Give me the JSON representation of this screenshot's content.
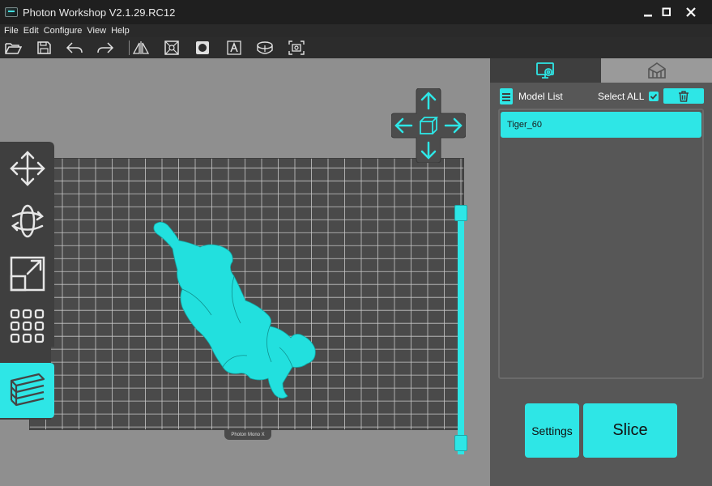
{
  "window": {
    "title": "Photon Workshop V2.1.29.RC12",
    "icon": "app-icon",
    "controls": [
      "minimize-icon",
      "maximize-icon",
      "close-icon"
    ]
  },
  "menu": {
    "items": [
      "File",
      "Edit",
      "Configure",
      "View",
      "Help"
    ]
  },
  "toolbar": {
    "buttons": [
      "open-folder-icon",
      "save-icon",
      "undo-icon",
      "redo-icon",
      "mirror-icon",
      "hollow-icon",
      "punch-hole-icon",
      "text-icon",
      "repair-icon",
      "screenshot-icon"
    ]
  },
  "left_tools": [
    "move-icon",
    "rotate-icon",
    "scale-icon",
    "arrange-icon",
    "layers-icon"
  ],
  "left_tools_active": "layers-icon",
  "view_controls": [
    "arrow-up-icon",
    "arrow-left-icon",
    "view-cube-icon",
    "arrow-right-icon",
    "arrow-down-icon"
  ],
  "build_plate": {
    "printer_label": "Photon Mono X"
  },
  "right_panel": {
    "tabs": [
      {
        "icon": "model-settings-icon",
        "active": true
      },
      {
        "icon": "supports-icon",
        "active": false
      }
    ],
    "model_list_label": "Model List",
    "select_all_label": "Select ALL",
    "select_all_checked": true,
    "delete_icon": "trash-icon",
    "models": [
      {
        "name": "Tiger_60",
        "selected": true
      }
    ]
  },
  "actions": {
    "settings_label": "Settings",
    "slice_label": "Slice"
  },
  "colors": {
    "accent": "#2ee6e6",
    "model": "#22e0de",
    "viewport_bg": "#8f8f8f",
    "plate": "#4a4a4a",
    "panel": "#575757",
    "titlebar": "#1f1f1f"
  }
}
